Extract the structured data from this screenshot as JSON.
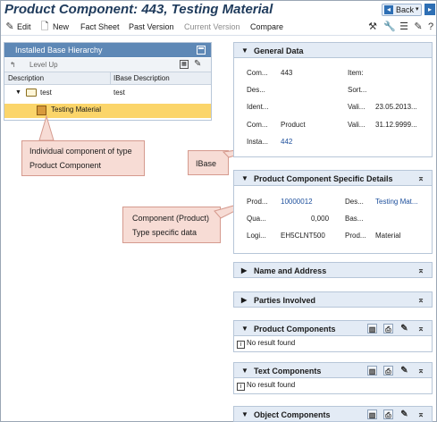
{
  "title": "Product Component: 443, Testing Material",
  "nav": {
    "back_label": "Back",
    "back_dropdown": "▾",
    "forward_icon": "arrow-right-icon"
  },
  "toolbar": {
    "edit": "Edit",
    "new": "New",
    "fact_sheet": "Fact Sheet",
    "past_version": "Past Version",
    "current_version": "Current Version",
    "compare": "Compare"
  },
  "hierarchy": {
    "title": "Installed Base Hierarchy",
    "level_up": "Level Up",
    "columns": [
      "Description",
      "IBase Description"
    ],
    "rows": [
      {
        "description": "test",
        "ibase_description": "test"
      },
      {
        "description": "Testing Material",
        "ibase_description": ""
      }
    ]
  },
  "callouts": {
    "component": "Individual component of type Product Component",
    "ibase": "IBase",
    "type_specific": "Component (Product) Type specific data"
  },
  "general_data": {
    "title": "General Data",
    "fields": [
      {
        "label": "Com...",
        "value": "443"
      },
      {
        "label": "Item:",
        "value": ""
      },
      {
        "label": "Des...",
        "value": ""
      },
      {
        "label": "Sort...",
        "value": ""
      },
      {
        "label": "Ident...",
        "value": ""
      },
      {
        "label": "Vali...",
        "value": "23.05.2013..."
      },
      {
        "label": "Com...",
        "value": "Product"
      },
      {
        "label": "Vali...",
        "value": "31.12.9999..."
      },
      {
        "label": "Insta...",
        "value": "442"
      }
    ]
  },
  "product_specific": {
    "title": "Product Component Specific Details",
    "fields": [
      {
        "label": "Prod...",
        "value": "10000012"
      },
      {
        "label": "Des...",
        "value": "Testing Mat..."
      },
      {
        "label": "Qua...",
        "value": "0,000"
      },
      {
        "label": "Bas...",
        "value": ""
      },
      {
        "label": "Logi...",
        "value": "EH5CLNT500"
      },
      {
        "label": "Prod...",
        "value": "Material"
      }
    ]
  },
  "sections": {
    "name_address": "Name and Address",
    "parties": "Parties Involved",
    "product_components": "Product Components",
    "text_components": "Text Components",
    "object_components": "Object Components"
  },
  "no_result": "No result found"
}
